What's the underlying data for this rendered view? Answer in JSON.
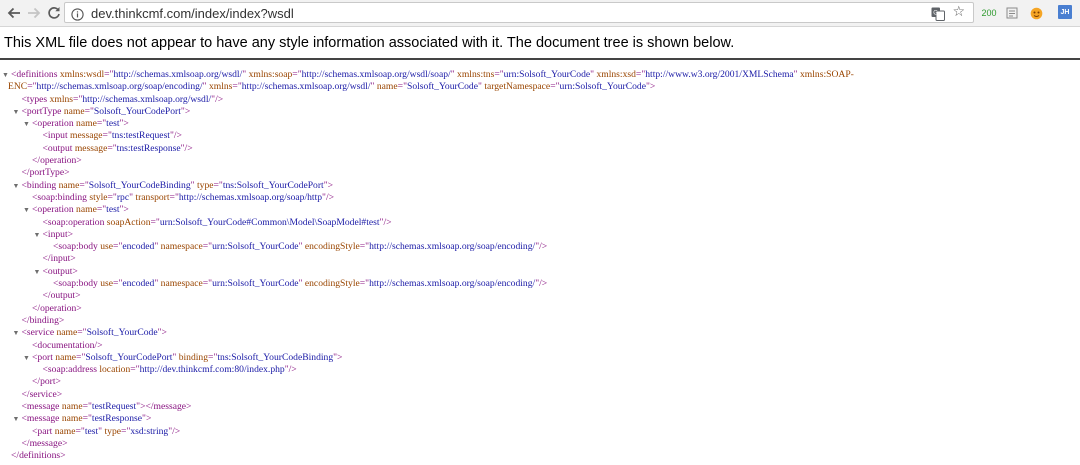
{
  "browser": {
    "url": "dev.thinkcmf.com/index/index?wsdl",
    "ext_counter": "200",
    "ext_profile": "JH"
  },
  "banner_text": "This XML file does not appear to have any style information associated with it. The document tree is shown below.",
  "xml_lines": [
    {
      "indent": 0,
      "toggle": true,
      "parts": [
        [
          "t",
          "<definitions "
        ],
        [
          "a",
          "xmlns:wsdl"
        ],
        [
          "t",
          "=\""
        ],
        [
          "v",
          "http://schemas.xmlsoap.org/wsdl/"
        ],
        [
          "t",
          "\" "
        ],
        [
          "a",
          "xmlns:soap"
        ],
        [
          "t",
          "=\""
        ],
        [
          "v",
          "http://schemas.xmlsoap.org/wsdl/soap/"
        ],
        [
          "t",
          "\" "
        ],
        [
          "a",
          "xmlns:tns"
        ],
        [
          "t",
          "=\""
        ],
        [
          "v",
          "urn:Solsoft_YourCode"
        ],
        [
          "t",
          "\" "
        ],
        [
          "a",
          "xmlns:xsd"
        ],
        [
          "t",
          "=\""
        ],
        [
          "v",
          "http://www.w3.org/2001/XMLSchema"
        ],
        [
          "t",
          "\" "
        ],
        [
          "a",
          "xmlns:SOAP-"
        ]
      ]
    },
    {
      "indent": 0,
      "toggle": false,
      "parts": [
        [
          "a",
          "ENC"
        ],
        [
          "t",
          "=\""
        ],
        [
          "v",
          "http://schemas.xmlsoap.org/soap/encoding/"
        ],
        [
          "t",
          "\" "
        ],
        [
          "a",
          "xmlns"
        ],
        [
          "t",
          "=\""
        ],
        [
          "v",
          "http://schemas.xmlsoap.org/wsdl/"
        ],
        [
          "t",
          "\" "
        ],
        [
          "a",
          "name"
        ],
        [
          "t",
          "=\""
        ],
        [
          "v",
          "Solsoft_YourCode"
        ],
        [
          "t",
          "\" "
        ],
        [
          "a",
          "targetNamespace"
        ],
        [
          "t",
          "=\""
        ],
        [
          "v",
          "urn:Solsoft_YourCode"
        ],
        [
          "t",
          "\">"
        ]
      ]
    },
    {
      "indent": 1,
      "toggle": false,
      "parts": [
        [
          "t",
          "<types "
        ],
        [
          "a",
          "xmlns"
        ],
        [
          "t",
          "=\""
        ],
        [
          "v",
          "http://schemas.xmlsoap.org/wsdl/"
        ],
        [
          "t",
          "\"/>"
        ]
      ]
    },
    {
      "indent": 1,
      "toggle": true,
      "parts": [
        [
          "t",
          "<portType "
        ],
        [
          "a",
          "name"
        ],
        [
          "t",
          "=\""
        ],
        [
          "v",
          "Solsoft_YourCodePort"
        ],
        [
          "t",
          "\">"
        ]
      ]
    },
    {
      "indent": 2,
      "toggle": true,
      "parts": [
        [
          "t",
          "<operation "
        ],
        [
          "a",
          "name"
        ],
        [
          "t",
          "=\""
        ],
        [
          "v",
          "test"
        ],
        [
          "t",
          "\">"
        ]
      ]
    },
    {
      "indent": 3,
      "toggle": false,
      "parts": [
        [
          "t",
          "<input "
        ],
        [
          "a",
          "message"
        ],
        [
          "t",
          "=\""
        ],
        [
          "v",
          "tns:testRequest"
        ],
        [
          "t",
          "\"/>"
        ]
      ]
    },
    {
      "indent": 3,
      "toggle": false,
      "parts": [
        [
          "t",
          "<output "
        ],
        [
          "a",
          "message"
        ],
        [
          "t",
          "=\""
        ],
        [
          "v",
          "tns:testResponse"
        ],
        [
          "t",
          "\"/>"
        ]
      ]
    },
    {
      "indent": 2,
      "toggle": false,
      "parts": [
        [
          "t",
          "</operation>"
        ]
      ]
    },
    {
      "indent": 1,
      "toggle": false,
      "parts": [
        [
          "t",
          "</portType>"
        ]
      ]
    },
    {
      "indent": 1,
      "toggle": true,
      "parts": [
        [
          "t",
          "<binding "
        ],
        [
          "a",
          "name"
        ],
        [
          "t",
          "=\""
        ],
        [
          "v",
          "Solsoft_YourCodeBinding"
        ],
        [
          "t",
          "\" "
        ],
        [
          "a",
          "type"
        ],
        [
          "t",
          "=\""
        ],
        [
          "v",
          "tns:Solsoft_YourCodePort"
        ],
        [
          "t",
          "\">"
        ]
      ]
    },
    {
      "indent": 2,
      "toggle": false,
      "parts": [
        [
          "t",
          "<soap:binding "
        ],
        [
          "a",
          "style"
        ],
        [
          "t",
          "=\""
        ],
        [
          "v",
          "rpc"
        ],
        [
          "t",
          "\" "
        ],
        [
          "a",
          "transport"
        ],
        [
          "t",
          "=\""
        ],
        [
          "v",
          "http://schemas.xmlsoap.org/soap/http"
        ],
        [
          "t",
          "\"/>"
        ]
      ]
    },
    {
      "indent": 2,
      "toggle": true,
      "parts": [
        [
          "t",
          "<operation "
        ],
        [
          "a",
          "name"
        ],
        [
          "t",
          "=\""
        ],
        [
          "v",
          "test"
        ],
        [
          "t",
          "\">"
        ]
      ]
    },
    {
      "indent": 3,
      "toggle": false,
      "parts": [
        [
          "t",
          "<soap:operation "
        ],
        [
          "a",
          "soapAction"
        ],
        [
          "t",
          "=\""
        ],
        [
          "v",
          "urn:Solsoft_YourCode#Common\\Model\\SoapModel#test"
        ],
        [
          "t",
          "\"/>"
        ]
      ]
    },
    {
      "indent": 3,
      "toggle": true,
      "parts": [
        [
          "t",
          "<input>"
        ]
      ]
    },
    {
      "indent": 4,
      "toggle": false,
      "parts": [
        [
          "t",
          "<soap:body "
        ],
        [
          "a",
          "use"
        ],
        [
          "t",
          "=\""
        ],
        [
          "v",
          "encoded"
        ],
        [
          "t",
          "\" "
        ],
        [
          "a",
          "namespace"
        ],
        [
          "t",
          "=\""
        ],
        [
          "v",
          "urn:Solsoft_YourCode"
        ],
        [
          "t",
          "\" "
        ],
        [
          "a",
          "encodingStyle"
        ],
        [
          "t",
          "=\""
        ],
        [
          "v",
          "http://schemas.xmlsoap.org/soap/encoding/"
        ],
        [
          "t",
          "\"/>"
        ]
      ]
    },
    {
      "indent": 3,
      "toggle": false,
      "parts": [
        [
          "t",
          "</input>"
        ]
      ]
    },
    {
      "indent": 3,
      "toggle": true,
      "parts": [
        [
          "t",
          "<output>"
        ]
      ]
    },
    {
      "indent": 4,
      "toggle": false,
      "parts": [
        [
          "t",
          "<soap:body "
        ],
        [
          "a",
          "use"
        ],
        [
          "t",
          "=\""
        ],
        [
          "v",
          "encoded"
        ],
        [
          "t",
          "\" "
        ],
        [
          "a",
          "namespace"
        ],
        [
          "t",
          "=\""
        ],
        [
          "v",
          "urn:Solsoft_YourCode"
        ],
        [
          "t",
          "\" "
        ],
        [
          "a",
          "encodingStyle"
        ],
        [
          "t",
          "=\""
        ],
        [
          "v",
          "http://schemas.xmlsoap.org/soap/encoding/"
        ],
        [
          "t",
          "\"/>"
        ]
      ]
    },
    {
      "indent": 3,
      "toggle": false,
      "parts": [
        [
          "t",
          "</output>"
        ]
      ]
    },
    {
      "indent": 2,
      "toggle": false,
      "parts": [
        [
          "t",
          "</operation>"
        ]
      ]
    },
    {
      "indent": 1,
      "toggle": false,
      "parts": [
        [
          "t",
          "</binding>"
        ]
      ]
    },
    {
      "indent": 1,
      "toggle": true,
      "parts": [
        [
          "t",
          "<service "
        ],
        [
          "a",
          "name"
        ],
        [
          "t",
          "=\""
        ],
        [
          "v",
          "Solsoft_YourCode"
        ],
        [
          "t",
          "\">"
        ]
      ]
    },
    {
      "indent": 2,
      "toggle": false,
      "parts": [
        [
          "t",
          "<documentation/>"
        ]
      ]
    },
    {
      "indent": 2,
      "toggle": true,
      "parts": [
        [
          "t",
          "<port "
        ],
        [
          "a",
          "name"
        ],
        [
          "t",
          "=\""
        ],
        [
          "v",
          "Solsoft_YourCodePort"
        ],
        [
          "t",
          "\" "
        ],
        [
          "a",
          "binding"
        ],
        [
          "t",
          "=\""
        ],
        [
          "v",
          "tns:Solsoft_YourCodeBinding"
        ],
        [
          "t",
          "\">"
        ]
      ]
    },
    {
      "indent": 3,
      "toggle": false,
      "parts": [
        [
          "t",
          "<soap:address "
        ],
        [
          "a",
          "location"
        ],
        [
          "t",
          "=\""
        ],
        [
          "v",
          "http://dev.thinkcmf.com:80/index.php"
        ],
        [
          "t",
          "\"/>"
        ]
      ]
    },
    {
      "indent": 2,
      "toggle": false,
      "parts": [
        [
          "t",
          "</port>"
        ]
      ]
    },
    {
      "indent": 1,
      "toggle": false,
      "parts": [
        [
          "t",
          "</service>"
        ]
      ]
    },
    {
      "indent": 1,
      "toggle": false,
      "parts": [
        [
          "t",
          "<message "
        ],
        [
          "a",
          "name"
        ],
        [
          "t",
          "=\""
        ],
        [
          "v",
          "testRequest"
        ],
        [
          "t",
          "\"></message>"
        ]
      ]
    },
    {
      "indent": 1,
      "toggle": true,
      "parts": [
        [
          "t",
          "<message "
        ],
        [
          "a",
          "name"
        ],
        [
          "t",
          "=\""
        ],
        [
          "v",
          "testResponse"
        ],
        [
          "t",
          "\">"
        ]
      ]
    },
    {
      "indent": 2,
      "toggle": false,
      "parts": [
        [
          "t",
          "<part "
        ],
        [
          "a",
          "name"
        ],
        [
          "t",
          "=\""
        ],
        [
          "v",
          "test"
        ],
        [
          "t",
          "\" "
        ],
        [
          "a",
          "type"
        ],
        [
          "t",
          "=\""
        ],
        [
          "v",
          "xsd:string"
        ],
        [
          "t",
          "\"/>"
        ]
      ]
    },
    {
      "indent": 1,
      "toggle": false,
      "parts": [
        [
          "t",
          "</message>"
        ]
      ]
    },
    {
      "indent": 0,
      "toggle": false,
      "parts": [
        [
          "t",
          "</definitions>"
        ]
      ]
    }
  ]
}
